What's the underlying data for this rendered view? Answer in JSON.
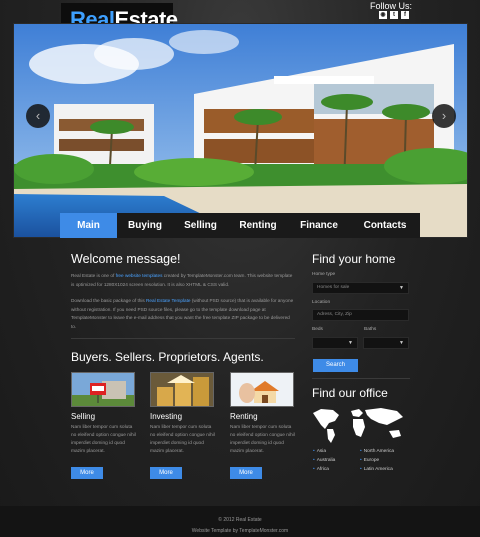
{
  "brand": {
    "part1": "Real",
    "part2": "Estate"
  },
  "follow": {
    "label": "Follow Us:",
    "icons": [
      "rss-icon",
      "twitter-icon",
      "facebook-icon"
    ]
  },
  "slider": {
    "prev": "‹",
    "next": "›"
  },
  "nav": [
    "Main",
    "Buying",
    "Selling",
    "Renting",
    "Finance",
    "Contacts"
  ],
  "welcome": {
    "title": "Welcome message!",
    "p1_a": "Real Estate is one of ",
    "p1_link": "free website templates",
    "p1_b": " created by TemplateMonster.com team. This website template is optimized for 1280X1024 screen resolution. It is also XHTML & CSS valid.",
    "p2_a": "Download the basic package of this ",
    "p2_link": "Real Estate Template",
    "p2_b": " (without PSD source) that is available for anyone without registration. If you need PSD source files, please go to the template download page at TemplateMonster to leave the e-mail address that you want the free template ZIP package to be delivered to."
  },
  "buyers_title": "Buyers. Sellers. Proprietors. Agents.",
  "features": [
    {
      "title": "Selling",
      "desc": "Nam liber tempor cum soluta no eleifend option congue nihil imperdiet doming id quod mazim placerat.",
      "button": "More"
    },
    {
      "title": "Investing",
      "desc": "Nam liber tempor cum soluta no eleifend option congue nihil imperdiet doming id quod mazim placerat.",
      "button": "More"
    },
    {
      "title": "Renting",
      "desc": "Nam liber tempor cum soluta no eleifend option congue nihil imperdiet doming id quod mazim placerat.",
      "button": "More"
    }
  ],
  "search": {
    "title": "Find your home",
    "home_type_label": "Home type",
    "home_type_value": "Homes for sale",
    "location_label": "Location",
    "location_placeholder": "Adress, City, Zip",
    "beds_label": "Beds",
    "baths_label": "Baths",
    "button": "Search"
  },
  "office": {
    "title": "Find our office",
    "regions": [
      "Asia",
      "North America",
      "Australia",
      "Europe",
      "Africa",
      "Latin America"
    ]
  },
  "footer": {
    "copyright": "© 2012 Real Estate",
    "credit": "Website Template by TemplateMonster.com"
  },
  "colors": {
    "accent": "#3e8be7",
    "background": "#222222",
    "logo_blue": "#3ea0ff"
  }
}
